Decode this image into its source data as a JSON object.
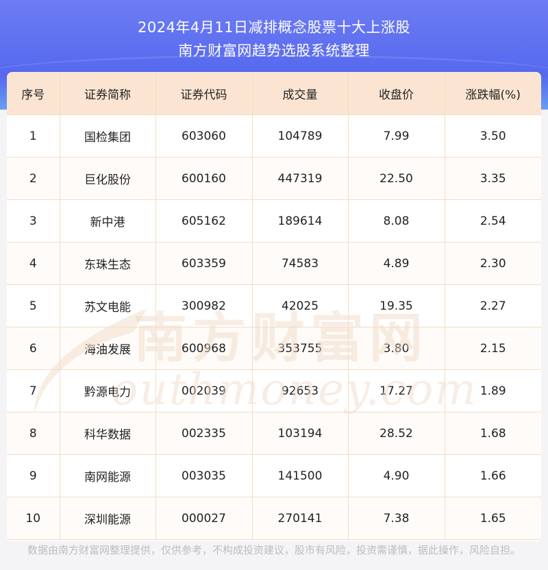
{
  "header": {
    "title_line1": "2024年4月11日减排概念股票十大上涨股",
    "title_line2": "南方财富网趋势选股系统整理"
  },
  "table": {
    "columns": [
      "序号",
      "证券简称",
      "证券代码",
      "成交量",
      "收盘价",
      "涨跌幅(%)"
    ],
    "rows": [
      [
        "1",
        "国检集团",
        "603060",
        "104789",
        "7.99",
        "3.50"
      ],
      [
        "2",
        "巨化股份",
        "600160",
        "447319",
        "22.50",
        "3.35"
      ],
      [
        "3",
        "新中港",
        "605162",
        "189614",
        "8.08",
        "2.54"
      ],
      [
        "4",
        "东珠生态",
        "603359",
        "74583",
        "4.89",
        "2.30"
      ],
      [
        "5",
        "苏文电能",
        "300982",
        "42025",
        "19.35",
        "2.27"
      ],
      [
        "6",
        "海油发展",
        "600968",
        "353755",
        "3.80",
        "2.15"
      ],
      [
        "7",
        "黔源电力",
        "002039",
        "92653",
        "17.27",
        "1.89"
      ],
      [
        "8",
        "科华数据",
        "002335",
        "103194",
        "28.52",
        "1.68"
      ],
      [
        "9",
        "南网能源",
        "003035",
        "141500",
        "4.90",
        "1.66"
      ],
      [
        "10",
        "深圳能源",
        "000027",
        "270141",
        "7.38",
        "1.65"
      ]
    ]
  },
  "watermark": {
    "cn": "南方财富网",
    "en": "outhmoney.com"
  },
  "footer": {
    "disclaimer": "数据由南方财富网整理提供，仅供参考，不构成投资建议，股市有风险，投资需谨慎，据此操作，风险自担。"
  },
  "colors": {
    "header_bg": "#5a6cef",
    "table_head_bg": "#fbe5d2",
    "grid_line": "#f3dcc6",
    "watermark": "#f0d9c4"
  }
}
